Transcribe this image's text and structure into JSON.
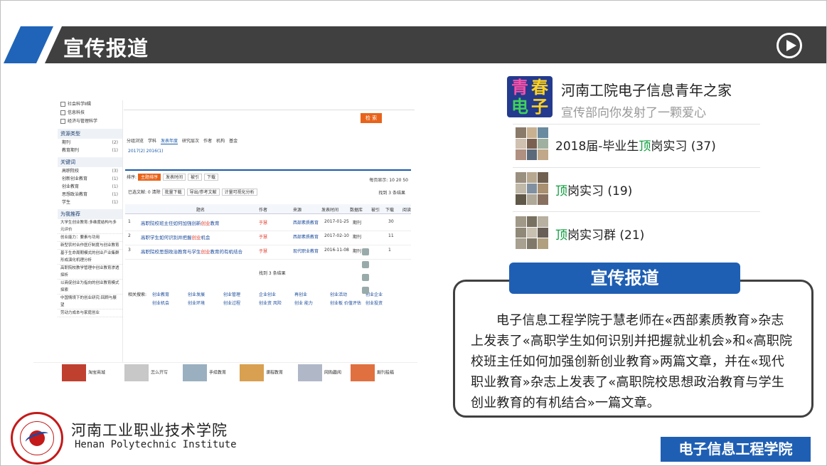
{
  "header": {
    "title": "宣传报道",
    "play_icon": "play-circle-icon"
  },
  "screenshot": {
    "side_checks": [
      "社会科学Ⅱ辑",
      "信息科技",
      "经济与管理科学"
    ],
    "resource_type_title": "资源类型",
    "resource_types": [
      {
        "label": "期刊",
        "count": "(2)"
      },
      {
        "label": "教育期刊",
        "count": "(1)"
      }
    ],
    "keyword_title": "关键词",
    "keywords": [
      {
        "label": "高职院校",
        "count": "(3)"
      },
      {
        "label": "创新创业教育",
        "count": "(1)"
      },
      {
        "label": "创业教育",
        "count": "(1)"
      },
      {
        "label": "思想政治教育",
        "count": "(1)"
      },
      {
        "label": "学生",
        "count": "(1)"
      }
    ],
    "recommend_title": "为我推荐",
    "recommend": [
      "大学生创业教育:多维度结构与多元评价",
      "创业能力：要素与功用",
      "新型农村合作医疗制度与创业教育",
      "基于生命周期模式的创业产业集群形成演化机理分析",
      "高职院校教学管理中创业教育渗透探析",
      "以商促创业为指向的创业教育模式探索",
      "中国情境下的创业研究:回顾与展望",
      "劳动力成本与家庭创业"
    ],
    "search_btn": "检 索",
    "tabs": [
      "分组浏览",
      "学科",
      "发表年度",
      "研究层次",
      "作者",
      "机构",
      "基金"
    ],
    "years": "2017(2)   2016(1)",
    "sort_label": "排序:",
    "sort_buttons": [
      "主题排序",
      "发表时间",
      "被引",
      "下载"
    ],
    "per_page": "每页显示: 10 20 50",
    "selected": "已选文献: 0  清除",
    "actions": [
      "批量下载",
      "导出/参考文献",
      "计量可视化分析"
    ],
    "found_top": "找到 3 条结果",
    "columns": [
      "题名",
      "作者",
      "来源",
      "发表时间",
      "数据库",
      "被引",
      "下载",
      "阅读"
    ],
    "rows": [
      {
        "no": "1",
        "title_pre": "高职院校班主任如何加强创新",
        "title_hl": "创业",
        "title_post": "教育",
        "author": "于慧",
        "source": "西部素质教育",
        "date": "2017-01-25",
        "db": "期刊",
        "dl": "30"
      },
      {
        "no": "2",
        "title_pre": "高职学生如何识别并把握",
        "title_hl": "创业",
        "title_post": "机会",
        "author": "于慧",
        "source": "西部素质教育",
        "date": "2017-02-10",
        "db": "期刊",
        "dl": "11"
      },
      {
        "no": "3",
        "title_pre": "高职院校思想政治教育与学生",
        "title_hl": "创业",
        "title_post": "教育的有机结合",
        "author": "于慧",
        "source": "现代职业教育",
        "date": "2016-11-08",
        "db": "期刊",
        "dl": "1"
      }
    ],
    "found_bottom": "找到 3 条结果",
    "related_label": "相关搜索:",
    "related": [
      "创业教育",
      "创业发展",
      "创业管理",
      "企业创业",
      "再创业",
      "创业活动",
      "创业企业",
      "创业机会",
      "创业环境",
      "创业过程",
      "创业资 风险",
      "创业 能力",
      "创业板 价值评估",
      "创业投资"
    ],
    "strip": [
      "淘宝商城",
      "怎么开写",
      "手续教育",
      "课程教育",
      "网购趣闻",
      "期刊投稿"
    ]
  },
  "group": {
    "logo_text": [
      "青",
      "春",
      "电",
      "子"
    ],
    "name": "河南工院电子信息青年之家",
    "subtitle": "宣传部向你发射了一颗爱心",
    "items": [
      {
        "pre": "2018届-毕业生",
        "hl": "顶",
        "post": "岗实习 (37)"
      },
      {
        "pre": "",
        "hl": "顶",
        "post": "岗实习 (19)"
      },
      {
        "pre": "",
        "hl": "顶",
        "post": "岗实习群 (21)"
      }
    ]
  },
  "report": {
    "tag": "宣传报道",
    "text": "电子信息工程学院于慧老师在«西部素质教育»杂志上发表了«高职学生如何识别并把握就业机会»和«高职院校班主任如何加强创新创业教育»两篇文章，并在«现代职业教育»杂志上发表了«高职院校思想政治教育与学生创业教育的有机结合»一篇文章。"
  },
  "footer": {
    "school_cn": "河南工业职业技术学院",
    "school_en": "Henan Polytechnic Institute",
    "dept": "电子信息工程学院"
  },
  "colors": {
    "accent_blue": "#1f5fb3",
    "header_dark": "#404040",
    "highlight_green": "#0a9c3a",
    "search_orange": "#e8631a"
  }
}
